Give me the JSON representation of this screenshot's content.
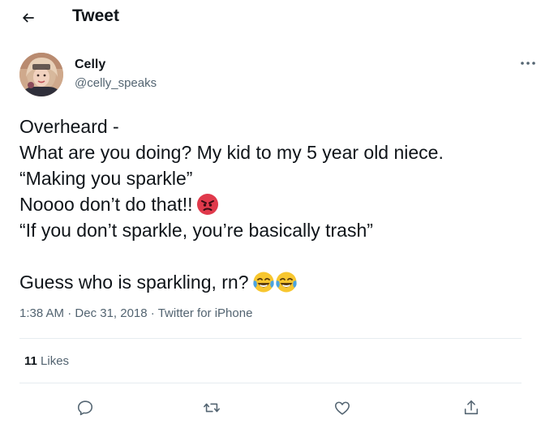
{
  "header": {
    "title": "Tweet",
    "back_icon": "arrow-left-icon"
  },
  "author": {
    "name": "Celly",
    "handle": "@celly_speaks",
    "avatar_icon": "avatar"
  },
  "tweet": {
    "lines": [
      "Overheard -",
      "What are you doing? My kid to my 5 year old niece.",
      "“Making you sparkle”",
      "Noooo don’t do that!!",
      "“If you don’t sparkle, you’re basically trash”",
      "Guess who is sparkling, rn?"
    ],
    "emoji": {
      "angry": "angry-face-emoji",
      "laugh": "tears-of-joy-emoji"
    }
  },
  "meta": {
    "time": "1:38 AM",
    "separator": " · ",
    "date": "Dec 31, 2018",
    "source": "Twitter for iPhone"
  },
  "stats": {
    "likes_count": "11",
    "likes_label": "Likes"
  },
  "actions": {
    "reply_icon": "reply-icon",
    "retweet_icon": "retweet-icon",
    "like_icon": "like-icon",
    "share_icon": "share-icon"
  },
  "colors": {
    "text_primary": "#0f1419",
    "text_secondary": "#536471",
    "divider": "#e6ecf0"
  }
}
